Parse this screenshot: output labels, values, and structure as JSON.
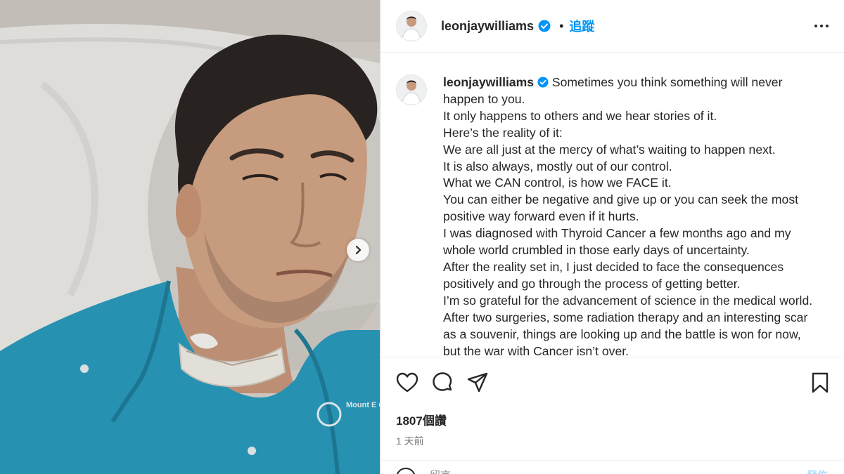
{
  "post": {
    "username": "leonjaywilliams",
    "follow_label": "追蹤",
    "separator": "•",
    "likes": "1807個讚",
    "time": "1 天前",
    "caption_lines": [
      "Sometimes you think something will never",
      "happen to you.",
      "It only happens to others and we hear stories of it.",
      "Here’s the reality of it:",
      "We are all just at the mercy of what’s waiting to happen next.",
      "It is also always, mostly out of our control.",
      "What we CAN control, is how we FACE it.",
      "You can either be negative and give up or you can seek the most",
      "positive way forward even if it hurts.",
      "I was diagnosed with Thyroid Cancer a few months ago and my",
      "whole world crumbled in those early days of uncertainty.",
      "After the reality set in, I just decided to face the consequences",
      "positively and go through the process of getting better.",
      "I’m so grateful for the advancement of science in the medical world.",
      "After two surgeries, some radiation therapy and an interesting scar",
      "as a souvenir, things are looking up and the battle is won for now,",
      "but the war with Cancer isn’t over."
    ]
  },
  "photo": {
    "shirt_text": "Mount E ORCHARD"
  },
  "comment": {
    "placeholder": "留言……",
    "post_label": "發佈"
  },
  "icons": {
    "verified": "verified-badge-icon",
    "like": "heart-icon",
    "comment": "comment-icon",
    "share": "paper-plane-icon",
    "save": "bookmark-icon",
    "next": "chevron-right-icon",
    "more": "more-options-icon"
  },
  "colors": {
    "accent": "#0095f6",
    "verified": "#0095f6",
    "text": "#262626",
    "muted": "#737373",
    "shirt": "#2a9bbd"
  }
}
